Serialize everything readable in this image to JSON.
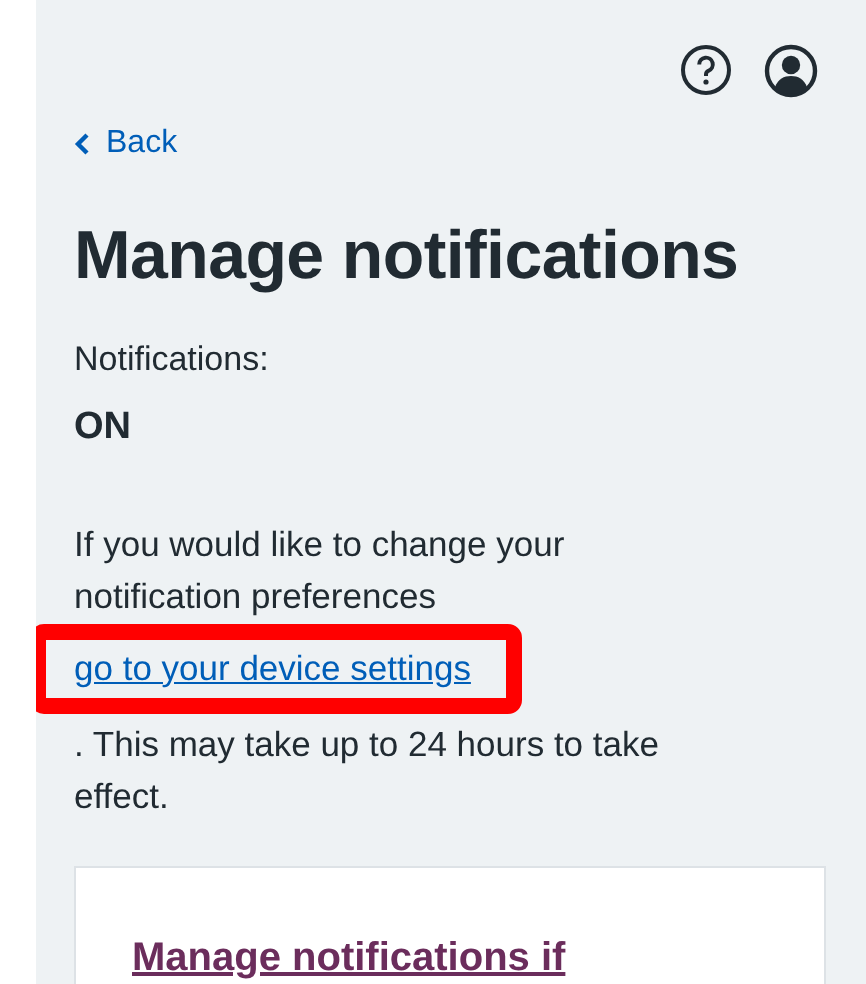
{
  "back_link": {
    "label": "Back"
  },
  "title": "Manage notifications",
  "status": {
    "label": "Notifications:",
    "value": "ON"
  },
  "info": {
    "text_before": "If you would like to change your notification preferences",
    "link": "go to your device settings",
    "text_after": ". This may take up to 24 hours to take effect.",
    "highlighted": true
  },
  "card": {
    "link": "Manage notifications if"
  }
}
